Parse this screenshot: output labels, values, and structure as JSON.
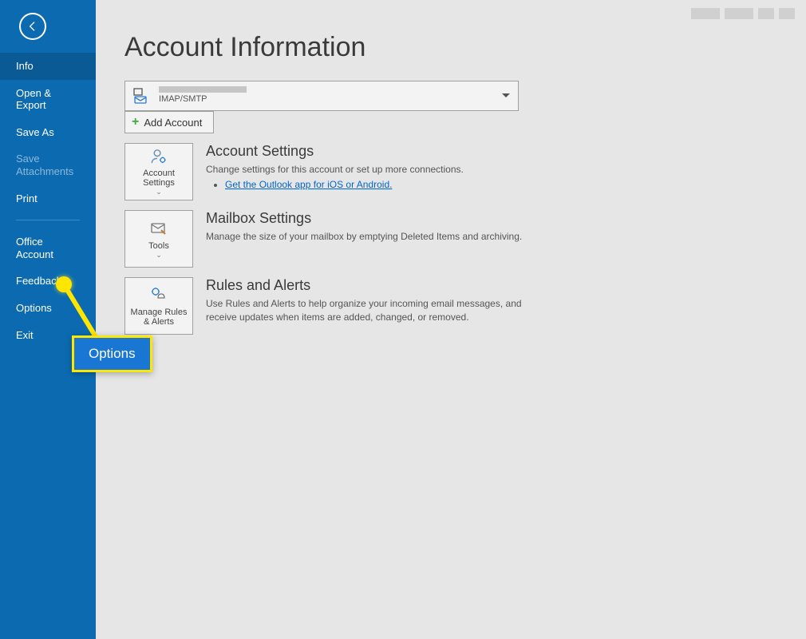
{
  "sidebar": {
    "items": [
      {
        "label": "Info",
        "active": true
      },
      {
        "label": "Open & Export"
      },
      {
        "label": "Save As"
      },
      {
        "label": "Save Attachments",
        "disabled": true
      },
      {
        "label": "Print"
      },
      {
        "label": "Office Account"
      },
      {
        "label": "Feedback"
      },
      {
        "label": "Options"
      },
      {
        "label": "Exit"
      }
    ]
  },
  "page": {
    "title": "Account Information",
    "account_type": "IMAP/SMTP",
    "add_account": "Add Account"
  },
  "sections": {
    "account_settings": {
      "tile": "Account Settings",
      "title": "Account Settings",
      "desc": "Change settings for this account or set up more connections.",
      "link": "Get the Outlook app for iOS or Android."
    },
    "mailbox": {
      "tile": "Tools",
      "title": "Mailbox Settings",
      "desc": "Manage the size of your mailbox by emptying Deleted Items and archiving."
    },
    "rules": {
      "tile": "Manage Rules & Alerts",
      "title": "Rules and Alerts",
      "desc": "Use Rules and Alerts to help organize your incoming email messages, and receive updates when items are added, changed, or removed."
    }
  },
  "callout": {
    "label": "Options"
  }
}
